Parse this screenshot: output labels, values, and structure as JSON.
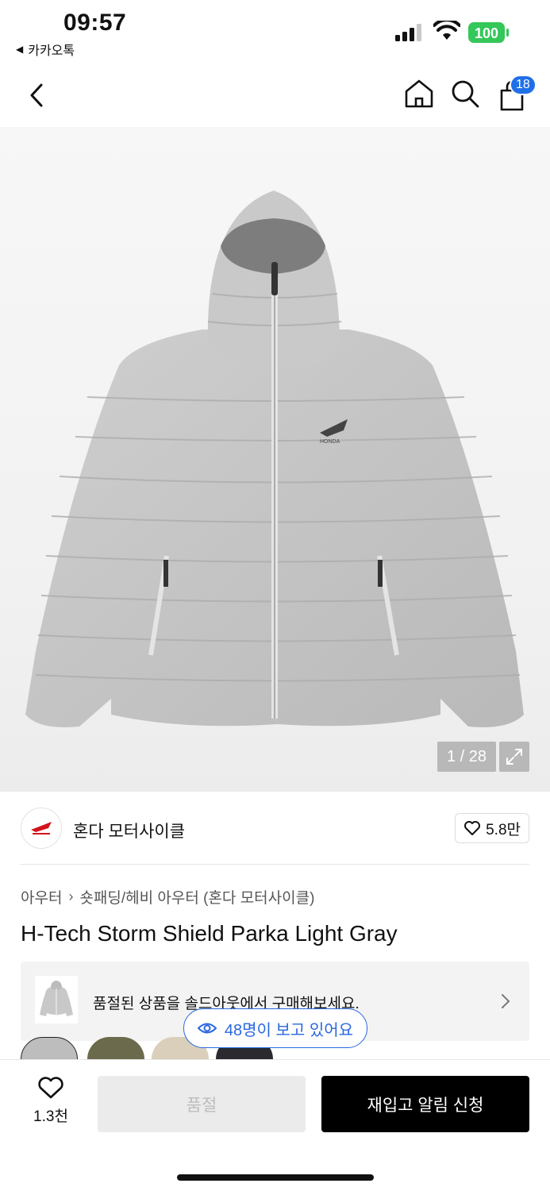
{
  "status_bar": {
    "time": "09:57",
    "back_app": "카카오톡",
    "battery": "100"
  },
  "nav": {
    "cart_count": "18"
  },
  "gallery": {
    "counter": "1 / 28"
  },
  "brand": {
    "name": "혼다 모터사이클",
    "likes": "5.8만"
  },
  "breadcrumb": [
    "아우터",
    "숏패딩/헤비 아우터 (혼다 모터사이클)"
  ],
  "product": {
    "title": "H-Tech Storm Shield Parka Light Gray"
  },
  "soldout_banner": {
    "text": "품절된 상품을 솔드아웃에서 구매해보세요."
  },
  "viewers": {
    "text": "48명이 보고 있어요"
  },
  "bottom_bar": {
    "wish_count": "1.3천",
    "soldout_label": "품절",
    "restock_label": "재입고 알림 신청"
  },
  "colors": {
    "accent": "#2a67e0",
    "badge": "#1f6fe8",
    "battery": "#34c759"
  }
}
